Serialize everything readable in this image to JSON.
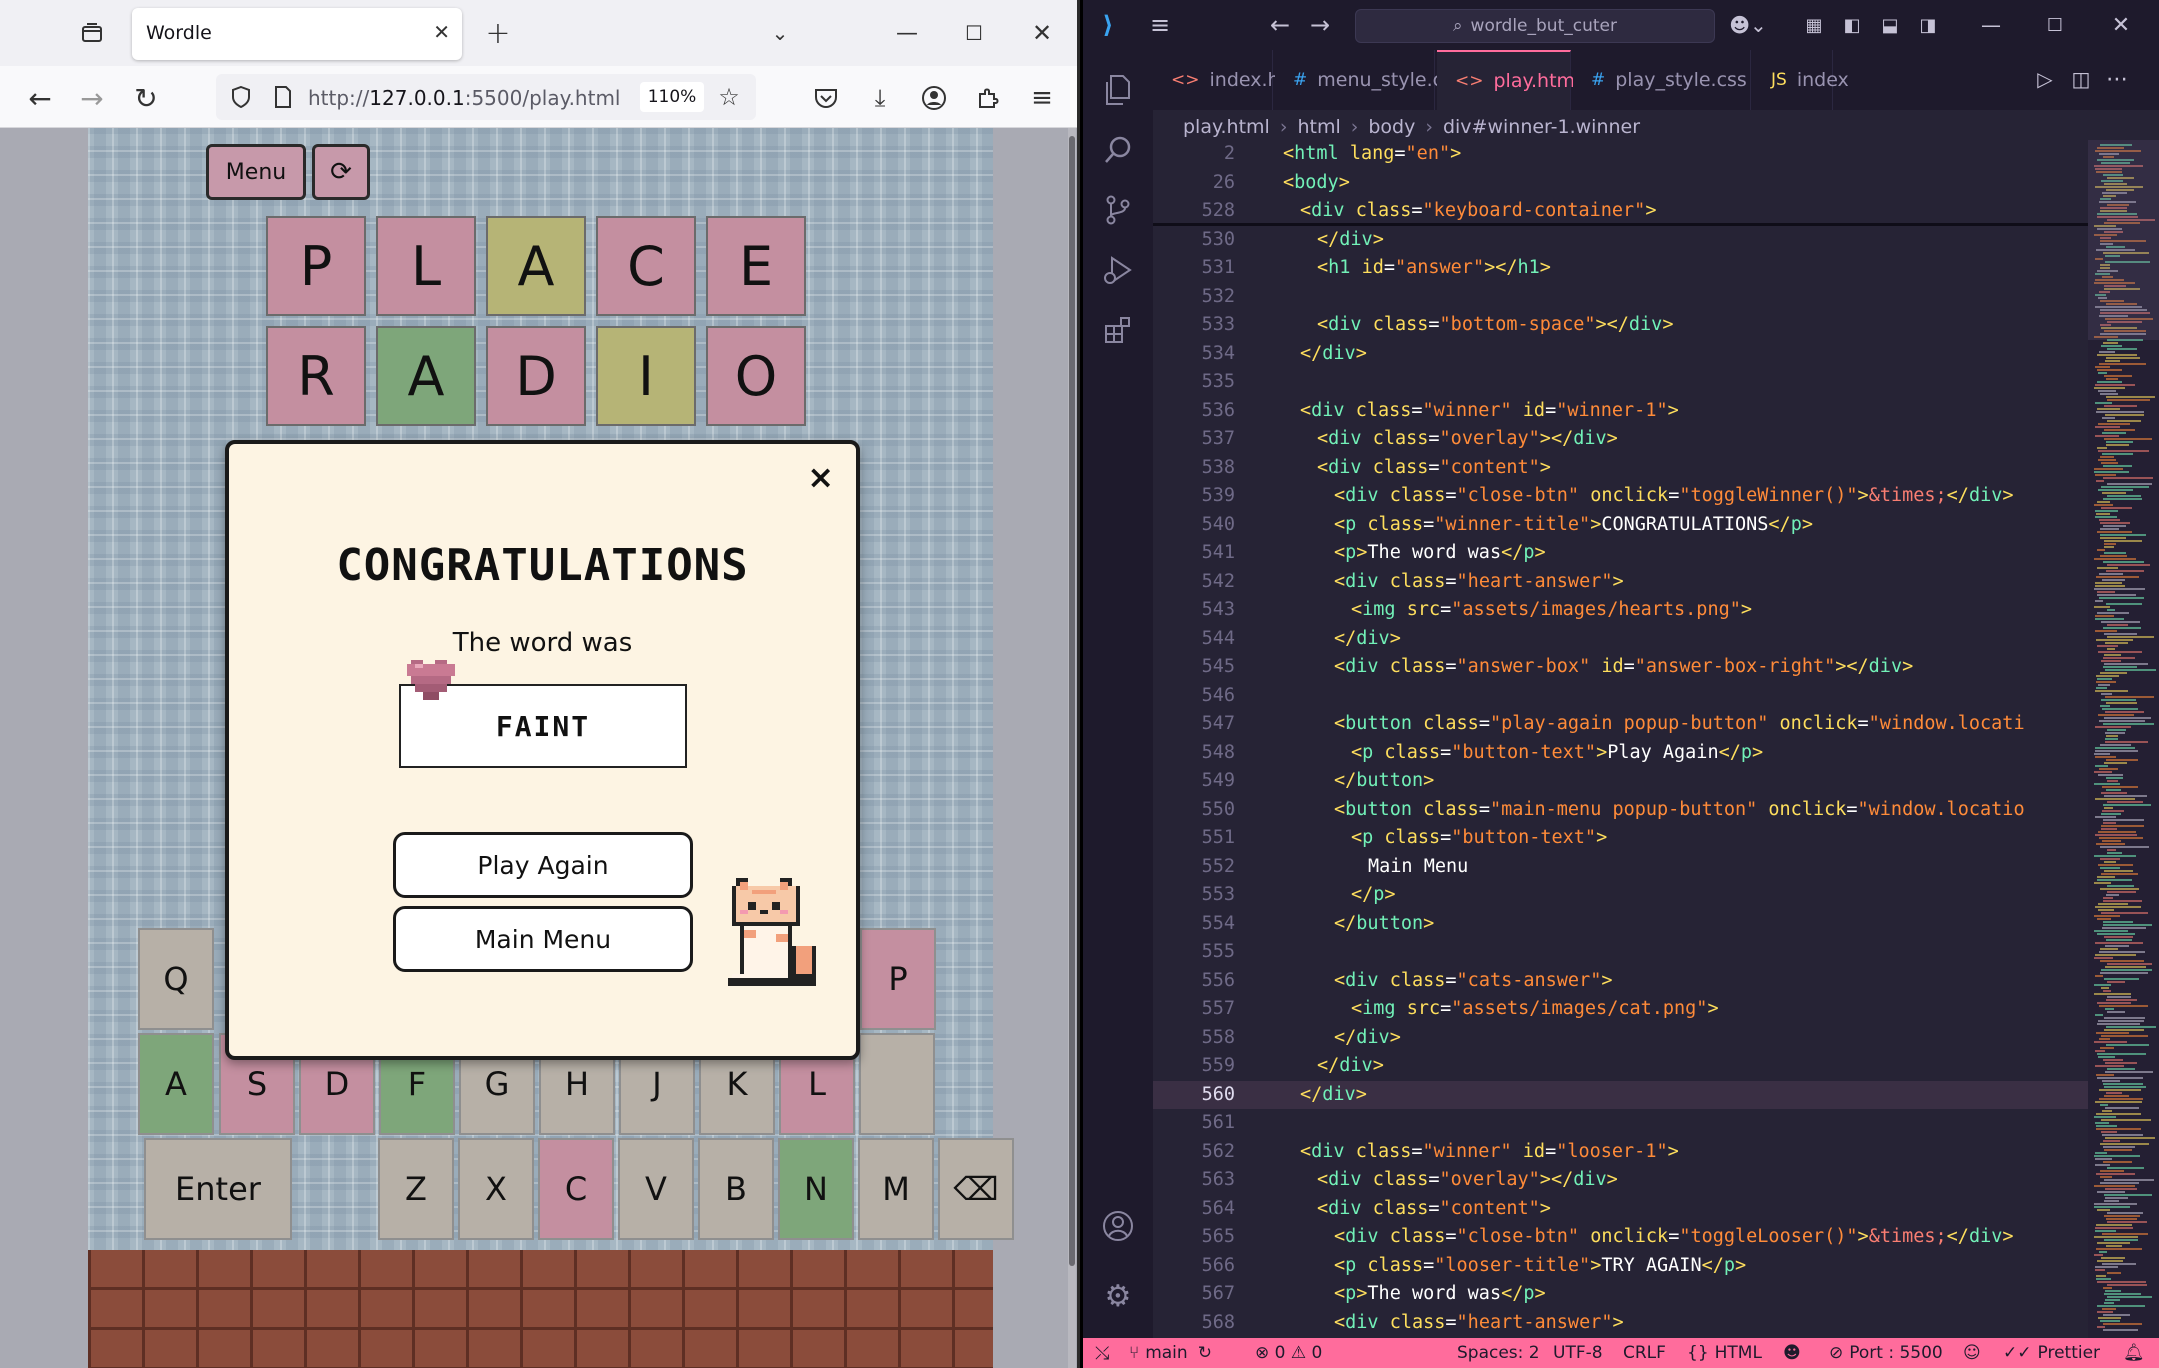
{
  "browser": {
    "tab_title": "Wordle",
    "tab_close": "✕",
    "new_tab": "+",
    "url_scheme": "http://",
    "url_host": "127.0.0.1",
    "url_rest": ":5500/play.html",
    "zoom": "110%"
  },
  "game": {
    "menu_label": "Menu",
    "restart_label": "⟳",
    "guesses": [
      {
        "letters": [
          "P",
          "L",
          "A",
          "C",
          "E"
        ],
        "states": [
          "pink",
          "pink",
          "yellow",
          "pink",
          "pink"
        ]
      },
      {
        "letters": [
          "R",
          "A",
          "D",
          "I",
          "O"
        ],
        "states": [
          "pink",
          "green",
          "pink",
          "yellow",
          "pink"
        ]
      }
    ],
    "keyboard": {
      "row1": [
        {
          "key": "Q",
          "state": "gray"
        },
        {
          "key": "P",
          "state": "pink"
        }
      ],
      "row2": [
        {
          "key": "A",
          "state": "green"
        },
        {
          "key": "S",
          "state": "pink"
        },
        {
          "key": "D",
          "state": "pink"
        },
        {
          "key": "F",
          "state": "green"
        },
        {
          "key": "G",
          "state": "gray"
        },
        {
          "key": "H",
          "state": "gray"
        },
        {
          "key": "J",
          "state": "gray"
        },
        {
          "key": "K",
          "state": "gray"
        },
        {
          "key": "L",
          "state": "pink"
        },
        {
          "key": "",
          "state": "gray"
        }
      ],
      "row3": [
        {
          "key": "Enter",
          "state": "gray"
        },
        {
          "key": "Z",
          "state": "gray"
        },
        {
          "key": "X",
          "state": "gray"
        },
        {
          "key": "C",
          "state": "pink"
        },
        {
          "key": "V",
          "state": "gray"
        },
        {
          "key": "B",
          "state": "gray"
        },
        {
          "key": "N",
          "state": "green"
        },
        {
          "key": "M",
          "state": "gray"
        },
        {
          "key": "⌫",
          "state": "gray"
        }
      ]
    },
    "modal": {
      "close": "×",
      "title": "CONGRATULATIONS",
      "subtitle": "The word was",
      "answer": "FAINT",
      "play_again": "Play Again",
      "main_menu": "Main Menu"
    }
  },
  "vscode": {
    "search_text": "wordle_but_cuter",
    "tabs": [
      {
        "icon": "<>",
        "label": "index.html"
      },
      {
        "icon": "#",
        "label": "menu_style.css"
      },
      {
        "icon": "<>",
        "label": "play.html",
        "active": true
      },
      {
        "icon": "#",
        "label": "play_style.css"
      },
      {
        "icon": "JS",
        "label": "index"
      }
    ],
    "breadcrumb": [
      "play.html",
      "html",
      "body",
      "div#winner-1.winner"
    ],
    "code_lines": [
      {
        "n": "2",
        "indent": 0,
        "code": "<html lang=\"en\">",
        "sticky": true
      },
      {
        "n": "26",
        "indent": 0,
        "code": "<body>",
        "sticky": true
      },
      {
        "n": "528",
        "indent": 1,
        "code": "<div class=\"keyboard-container\">",
        "sticky": true
      },
      {
        "n": "530",
        "indent": 2,
        "code": "</div>"
      },
      {
        "n": "531",
        "indent": 2,
        "code": "<h1 id=\"answer\"></h1>"
      },
      {
        "n": "532",
        "indent": 0,
        "code": ""
      },
      {
        "n": "533",
        "indent": 2,
        "code": "<div class=\"bottom-space\"></div>"
      },
      {
        "n": "534",
        "indent": 1,
        "code": "</div>"
      },
      {
        "n": "535",
        "indent": 0,
        "code": ""
      },
      {
        "n": "536",
        "indent": 1,
        "code": "<div class=\"winner\" id=\"winner-1\">"
      },
      {
        "n": "537",
        "indent": 2,
        "code": "<div class=\"overlay\"></div>"
      },
      {
        "n": "538",
        "indent": 2,
        "code": "<div class=\"content\">"
      },
      {
        "n": "539",
        "indent": 3,
        "code": "<div class=\"close-btn\" onclick=\"toggleWinner()\">&times;</div>"
      },
      {
        "n": "540",
        "indent": 3,
        "code": "<p class=\"winner-title\">CONGRATULATIONS</p>"
      },
      {
        "n": "541",
        "indent": 3,
        "code": "<p>The word was</p>"
      },
      {
        "n": "542",
        "indent": 3,
        "code": "<div class=\"heart-answer\">"
      },
      {
        "n": "543",
        "indent": 4,
        "code": "<img src=\"assets/images/hearts.png\">"
      },
      {
        "n": "544",
        "indent": 3,
        "code": "</div>"
      },
      {
        "n": "545",
        "indent": 3,
        "code": "<div class=\"answer-box\" id=\"answer-box-right\"></div>"
      },
      {
        "n": "546",
        "indent": 0,
        "code": ""
      },
      {
        "n": "547",
        "indent": 3,
        "code": "<button class=\"play-again popup-button\" onclick=\"window.locati"
      },
      {
        "n": "548",
        "indent": 4,
        "code": "<p class=\"button-text\">Play Again</p>"
      },
      {
        "n": "549",
        "indent": 3,
        "code": "</button>"
      },
      {
        "n": "550",
        "indent": 3,
        "code": "<button class=\"main-menu popup-button\" onclick=\"window.locatio"
      },
      {
        "n": "551",
        "indent": 4,
        "code": "<p class=\"button-text\">"
      },
      {
        "n": "552",
        "indent": 5,
        "code": "Main Menu"
      },
      {
        "n": "553",
        "indent": 4,
        "code": "</p>"
      },
      {
        "n": "554",
        "indent": 3,
        "code": "</button>"
      },
      {
        "n": "555",
        "indent": 0,
        "code": ""
      },
      {
        "n": "556",
        "indent": 3,
        "code": "<div class=\"cats-answer\">"
      },
      {
        "n": "557",
        "indent": 4,
        "code": "<img src=\"assets/images/cat.png\">"
      },
      {
        "n": "558",
        "indent": 3,
        "code": "</div>"
      },
      {
        "n": "559",
        "indent": 2,
        "code": "</div>"
      },
      {
        "n": "560",
        "indent": 1,
        "code": "</div>",
        "current": true
      },
      {
        "n": "561",
        "indent": 0,
        "code": ""
      },
      {
        "n": "562",
        "indent": 1,
        "code": "<div class=\"winner\" id=\"looser-1\">"
      },
      {
        "n": "563",
        "indent": 2,
        "code": "<div class=\"overlay\"></div>"
      },
      {
        "n": "564",
        "indent": 2,
        "code": "<div class=\"content\">"
      },
      {
        "n": "565",
        "indent": 3,
        "code": "<div class=\"close-btn\" onclick=\"toggleLooser()\">&times;</div>"
      },
      {
        "n": "566",
        "indent": 3,
        "code": "<p class=\"looser-title\">TRY AGAIN</p>"
      },
      {
        "n": "567",
        "indent": 3,
        "code": "<p>The word was</p>"
      },
      {
        "n": "568",
        "indent": 3,
        "code": "<div class=\"heart-answer\">"
      }
    ],
    "status": {
      "branch": "main",
      "problems": "⊗ 0 ⚠ 0",
      "spaces": "Spaces: 2",
      "encoding": "UTF-8",
      "eol": "CRLF",
      "language": "HTML",
      "port": "Port : 5500",
      "prettier": "Prettier"
    },
    "theme_colors": {
      "accent": "#ff6c9c",
      "bg": "#262335"
    }
  }
}
